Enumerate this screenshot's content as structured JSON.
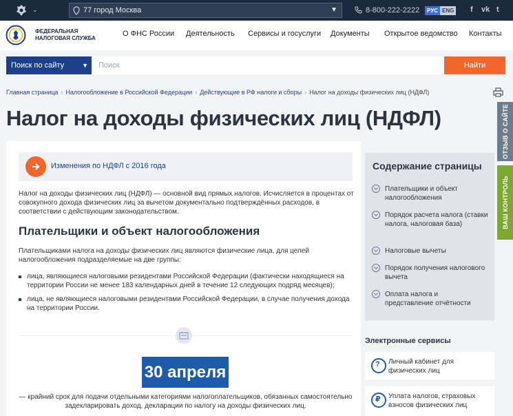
{
  "top_bar": {
    "region": "77 город Москва",
    "phone": "8-800-222-2222",
    "lang_ru": "РУС",
    "lang_en": "ENG",
    "social": [
      {
        "icon": "facebook-icon",
        "glyph": "f"
      },
      {
        "icon": "vk-icon",
        "glyph": "vk"
      },
      {
        "icon": "twitter-icon",
        "glyph": "t"
      }
    ]
  },
  "header": {
    "logo_line1": "Федеральная",
    "logo_line2": "налоговая служба",
    "nav": [
      "О ФНС России",
      "Деятельность",
      "Сервисы и госуслуги",
      "Документы",
      "Открытое ведомство",
      "Контакты"
    ]
  },
  "search": {
    "scope": "Поиск по сайту",
    "placeholder": "Поиск",
    "button": "Найти"
  },
  "breadcrumbs": [
    "Главная страница",
    "Налогообложение в Российской Федерации",
    "Действующие в РФ налоги и сборы"
  ],
  "breadcrumb_current": "Налог на доходы физических лиц (НДФЛ)",
  "page_title": "Налог на доходы физических лиц (НДФЛ)",
  "side_tabs": {
    "review": "ОТЗЫВ О САЙТЕ",
    "control": "ВАШ КОНТРОЛЬ"
  },
  "main": {
    "change_link": "Изменения по НДФЛ с 2016 года",
    "intro": "Налог на доходы физических лиц (НДФЛ) — основной вид прямых налогов. Исчисляется в процентах от совокупного дохода физических лиц за вычетом документально подтверждённых расходов, в соответствии с действующим законодательством.",
    "section_title": "Плательщики и объект налогообложения",
    "section_text": "Плательщиками налога на доходы физических лиц являются физические лица, для целей налогообложения подразделяемые на две группы:",
    "bullets": [
      "лица, являющиеся налоговыми резидентами Российской Федерации (фактически находящиеся на территории России не менее 183 календарных дней в течение 12 следующих подряд месяцев);",
      "лица, не являющиеся налоговыми резидентами Российской Федерации, в случае получения дохода на территории России."
    ],
    "date_badge": "30 апреля",
    "deadline_text": "— крайний срок для подачи отдельными категориями налогоплательщиков, обязанных самостоятельно задекларировать доход, декларации по налогу на доходы физических лиц."
  },
  "toc": {
    "title": "Содержание страницы",
    "items": [
      "Плательщики и объект налогообложения",
      "Порядок расчета налога (ставки налога, налоговая база)",
      "Налоговые вычеты",
      "Порядок получения налогового вычета",
      "Оплата налога и представление отчётности"
    ]
  },
  "services": {
    "title": "Электронные сервисы",
    "items": [
      {
        "label": "Личный кабинет для физических лиц",
        "icon": "personal-account-icon"
      },
      {
        "label": "Уплата налогов, страховых взносов физических лиц",
        "icon": "tax-payment-icon"
      }
    ]
  },
  "colors": {
    "topbar": "#1b2a3c",
    "brand_blue": "#1e3f8a",
    "accent_orange": "#f2652b",
    "badge_blue": "#1e5ba8",
    "control_green": "#7aa831"
  }
}
